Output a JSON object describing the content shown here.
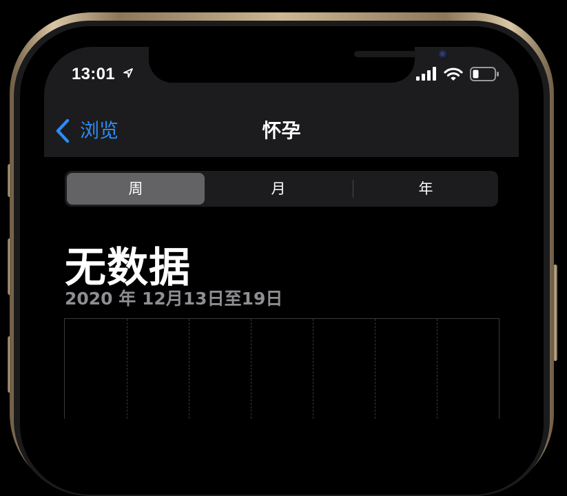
{
  "status_bar": {
    "time": "13:01",
    "icons": [
      "location-arrow-icon",
      "cellular-signal-icon",
      "wifi-icon",
      "battery-icon"
    ]
  },
  "nav": {
    "back_label": "浏览",
    "title": "怀孕",
    "accent_color": "#2C8CF4"
  },
  "segments": {
    "items": [
      "周",
      "月",
      "年"
    ],
    "selected": "周"
  },
  "main": {
    "headline": "无数据",
    "date_range": "2020 年 12月13日至19日"
  },
  "chart_data": {
    "type": "bar",
    "categories": [],
    "values": [],
    "columns": 7
  }
}
